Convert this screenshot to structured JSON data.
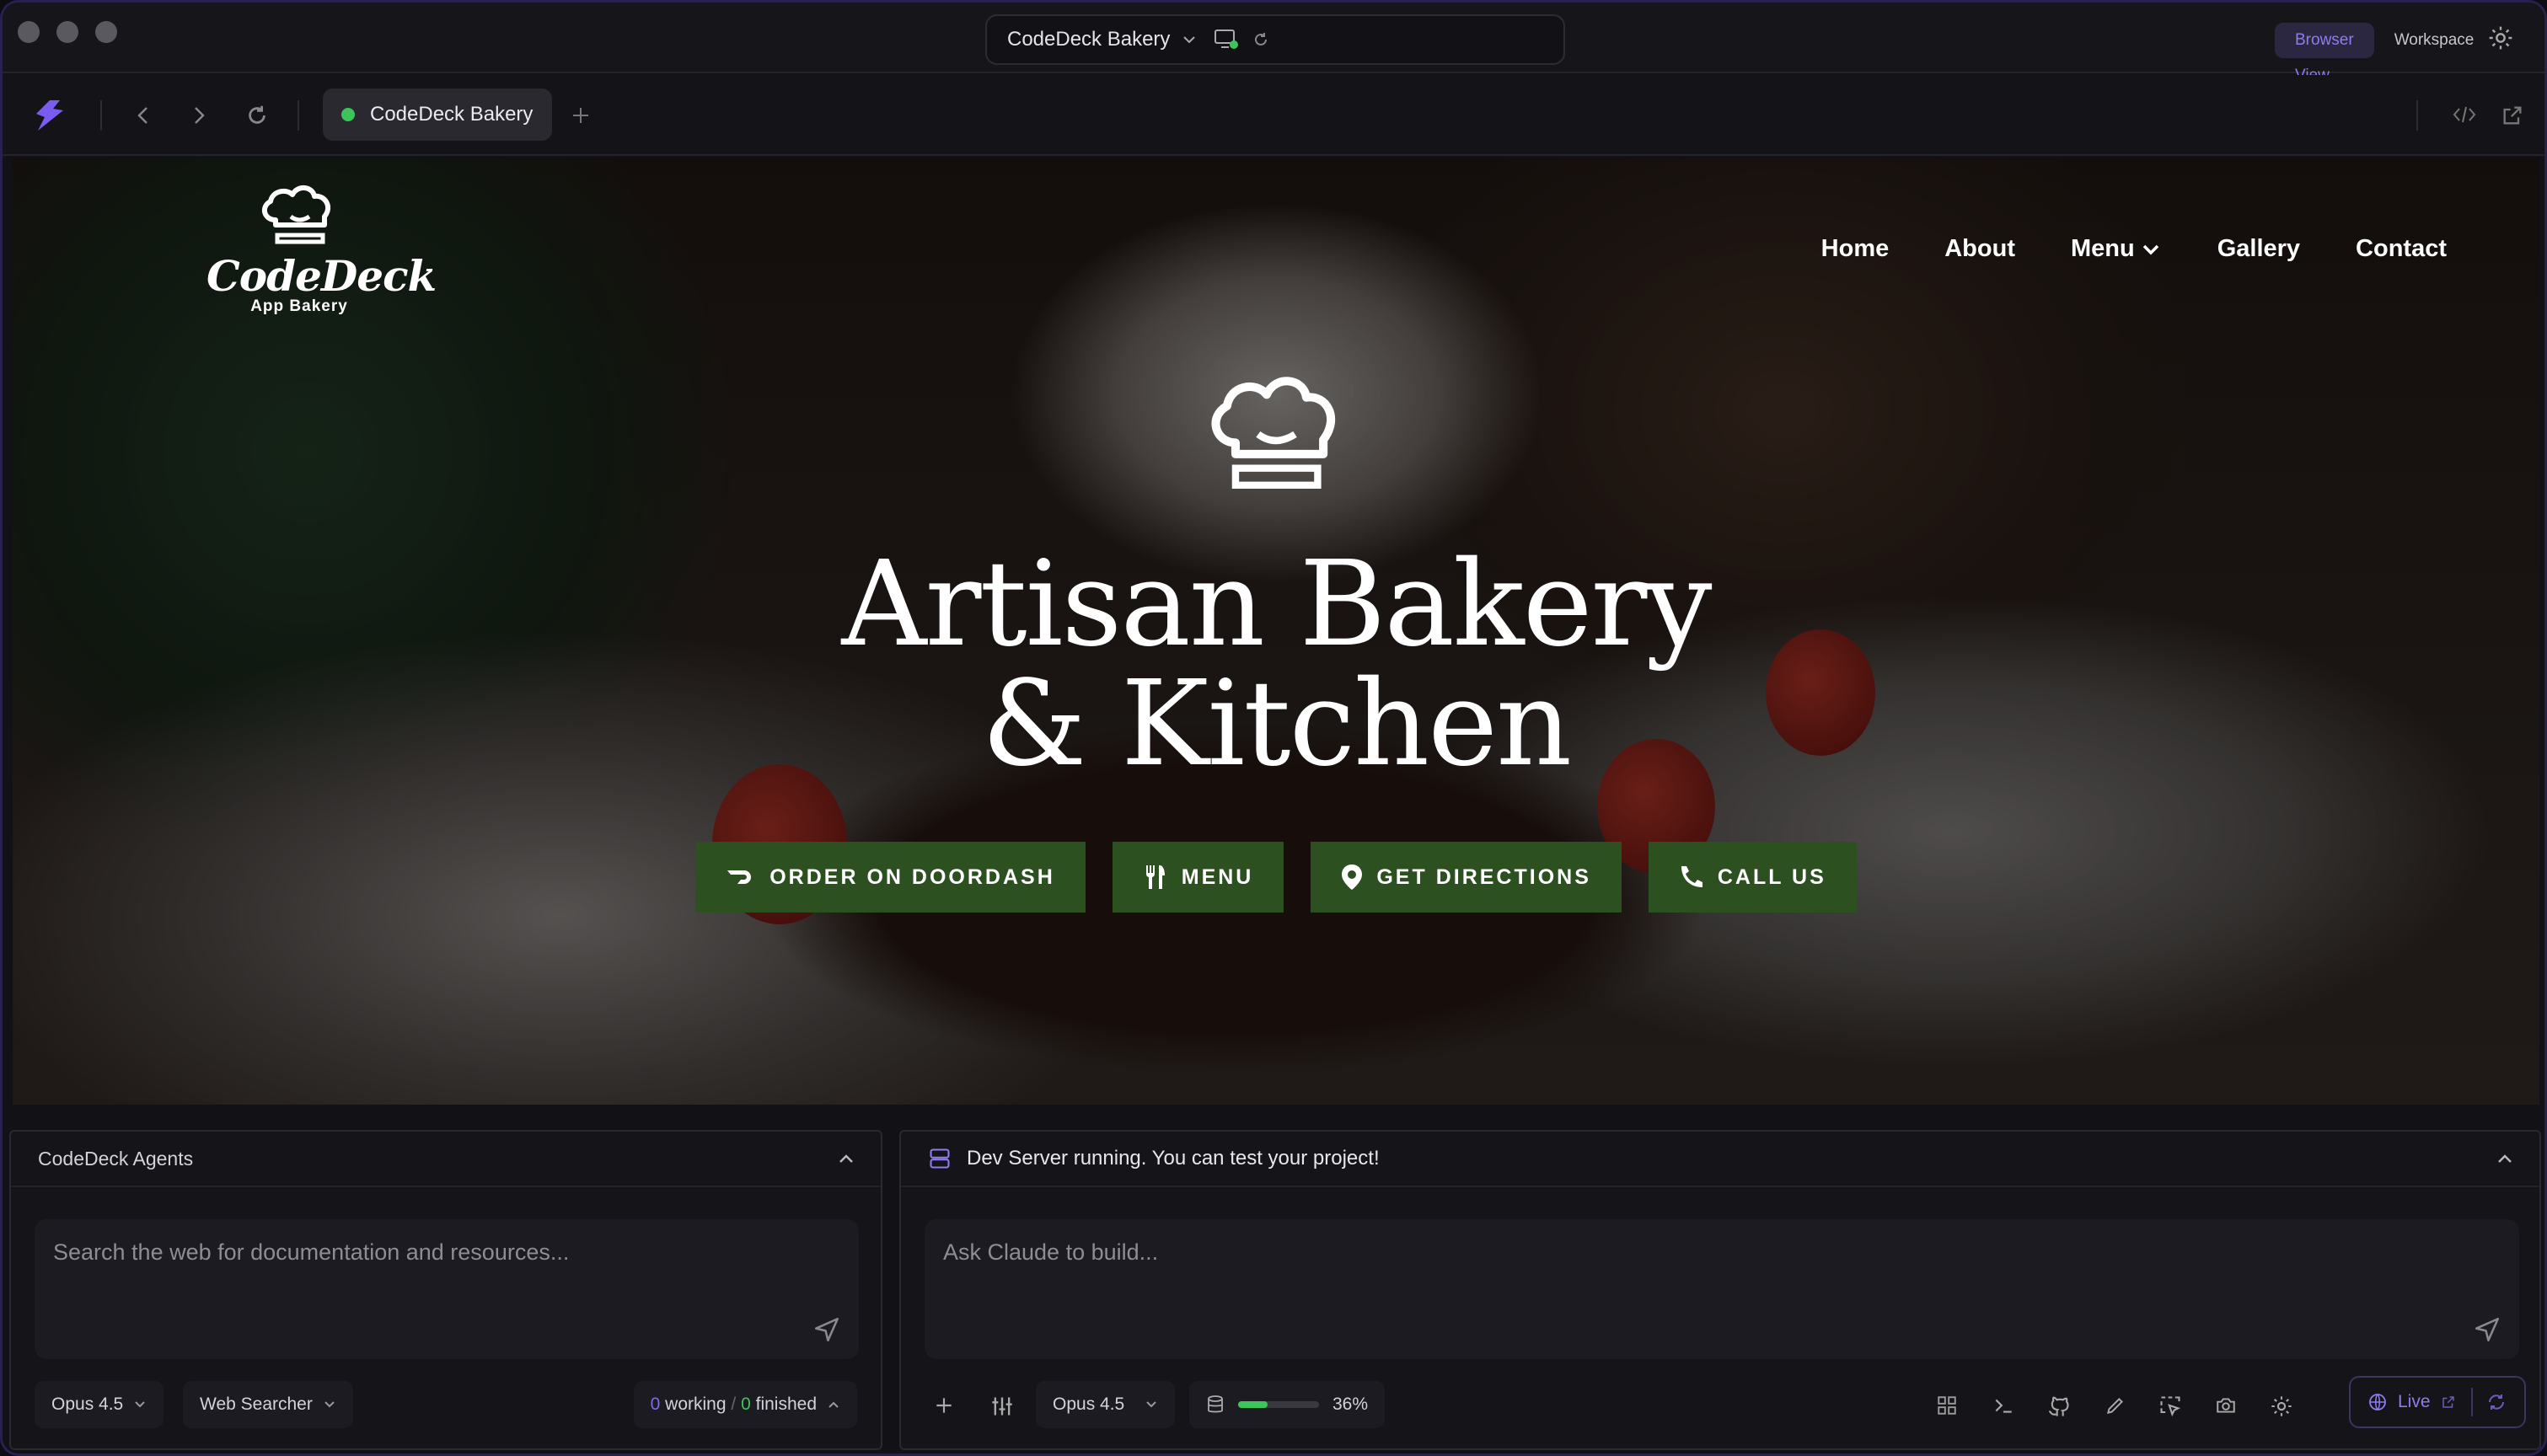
{
  "window": {
    "project_name": "CodeDeck Bakery",
    "view_tabs": [
      "Browser View",
      "Workspace"
    ],
    "active_view": "Browser View",
    "accent": "#8e7cf0"
  },
  "browser": {
    "tab_title": "CodeDeck Bakery",
    "tab_status_color": "#3bc55a"
  },
  "site": {
    "logo_text": "CodeDeck",
    "logo_sub": "App Bakery",
    "nav": [
      "Home",
      "About",
      "Menu",
      "Gallery",
      "Contact"
    ],
    "hero_line1": "Artisan Bakery",
    "hero_line2": "& Kitchen",
    "buttons": [
      "ORDER ON DOORDASH",
      "MENU",
      "GET DIRECTIONS",
      "CALL US"
    ],
    "button_color": "#2d5021"
  },
  "agents_panel": {
    "title": "CodeDeck Agents",
    "placeholder": "Search the web for documentation and resources...",
    "model": "Opus 4.5",
    "agent": "Web Searcher",
    "working_count": "0",
    "working_label": "working",
    "separator": "/",
    "finished_count": "0",
    "finished_label": "finished"
  },
  "dev_panel": {
    "status": "Dev Server running. You can test your project!",
    "placeholder": "Ask Claude to build...",
    "model": "Opus 4.5",
    "context_percent": 36,
    "context_label": "36%",
    "live_label": "Live"
  }
}
